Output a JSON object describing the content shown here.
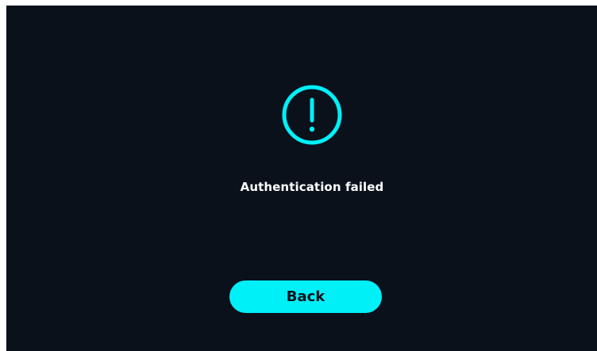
{
  "dialog": {
    "icon": "exclamation-circle-icon",
    "message": "Authentication failed",
    "back_label": "Back"
  },
  "colors": {
    "background": "#0a111b",
    "accent": "#00f0f8",
    "text": "#ffffff"
  }
}
